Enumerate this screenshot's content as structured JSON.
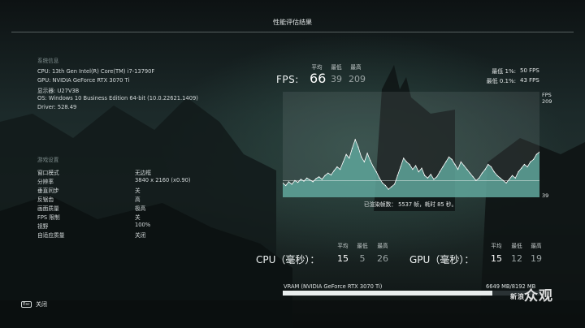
{
  "header": {
    "title": "性能评估结果"
  },
  "system": {
    "heading": "系统信息",
    "lines": [
      "CPU:  13th Gen Intel(R) Core(TM) i7-13790F",
      "GPU:  NVIDIA GeForce RTX 3070 Ti",
      "显示器:  U27V3B",
      "OS: Windows 10 Business Edition 64-bit (10.0.22621.1409)",
      "Driver: 528.49"
    ]
  },
  "settings": {
    "heading": "游戏设置",
    "items": [
      {
        "label": "窗口模式",
        "value": "无边框"
      },
      {
        "label": "分辨率",
        "value": "3840 x 2160 (x0.90)"
      },
      {
        "label": "垂直同步",
        "value": "关"
      },
      {
        "label": "反锯齿",
        "value": "高"
      },
      {
        "label": "画面质量",
        "value": "极高"
      },
      {
        "label": "FPS 限制",
        "value": "关"
      },
      {
        "label": "视野",
        "value": "100%"
      },
      {
        "label": "自适应质量",
        "value": "关闭"
      }
    ]
  },
  "fps": {
    "label": "FPS:",
    "avg_header": "平均",
    "min_header": "最低",
    "max_header": "最高",
    "avg": "66",
    "min": "39",
    "max": "209",
    "low1_label": "最低 1%:",
    "low1_value": "50 FPS",
    "low01_label": "最低 0.1%:",
    "low01_value": "43 FPS"
  },
  "chart_data": {
    "type": "area",
    "title": "",
    "xlabel": "",
    "ylabel": "FPS",
    "ylim": [
      39,
      209
    ],
    "ytick_labels": [
      "209",
      "39"
    ],
    "avg_line": 66,
    "grid": false,
    "x": [
      0,
      1,
      2,
      3,
      4,
      5,
      6,
      7,
      8,
      9,
      10,
      11,
      12,
      13,
      14,
      15,
      16,
      17,
      18,
      19,
      20,
      21,
      22,
      23,
      24,
      25,
      26,
      27,
      28,
      29,
      30,
      31,
      32,
      33,
      34,
      35,
      36,
      37,
      38,
      39,
      40,
      41,
      42,
      43,
      44,
      45,
      46,
      47,
      48,
      49,
      50,
      51,
      52,
      53,
      54,
      55,
      56,
      57,
      58,
      59,
      60,
      61,
      62,
      63,
      64,
      65,
      66,
      67,
      68,
      69,
      70,
      71,
      72,
      73,
      74,
      75,
      76,
      77,
      78,
      79,
      80,
      81,
      82,
      83,
      84,
      85
    ],
    "series": [
      {
        "name": "",
        "values": [
          62,
          58,
          64,
          60,
          66,
          63,
          68,
          65,
          70,
          67,
          64,
          69,
          72,
          68,
          74,
          78,
          75,
          82,
          88,
          84,
          96,
          108,
          102,
          118,
          132,
          120,
          104,
          96,
          110,
          98,
          88,
          80,
          70,
          62,
          58,
          52,
          56,
          60,
          74,
          88,
          102,
          96,
          92,
          84,
          90,
          80,
          86,
          74,
          70,
          76,
          68,
          72,
          80,
          88,
          96,
          104,
          100,
          92,
          84,
          96,
          90,
          84,
          78,
          72,
          66,
          70,
          78,
          84,
          92,
          88,
          80,
          74,
          70,
          66,
          62,
          68,
          74,
          70,
          80,
          86,
          92,
          88,
          96,
          100,
          108,
          112
        ]
      }
    ],
    "color_fill": "#5ea59a",
    "color_line": "#ffffff"
  },
  "rendered": {
    "text": "已渲染帧数： 5537 帧，耗时 85 秒。"
  },
  "cpu": {
    "label": "CPU（毫秒）：",
    "avg": "15",
    "min": "5",
    "max": "26"
  },
  "gpu": {
    "label": "GPU（毫秒）：",
    "avg": "15",
    "min": "12",
    "max": "19"
  },
  "vram": {
    "label": "VRAM (NVIDIA GeForce RTX 3070 Ti)",
    "value": "6649 MB/8192 MB",
    "used_fraction": 0.8117
  },
  "footer": {
    "esc_key": "Esc",
    "close_label": "关闭"
  },
  "watermark": {
    "big": "众",
    "big2": "观",
    "small": "新浪"
  },
  "colors": {
    "accent": "#5ea59a",
    "text": "#e6e9ea",
    "dim": "#9aa3a3"
  }
}
